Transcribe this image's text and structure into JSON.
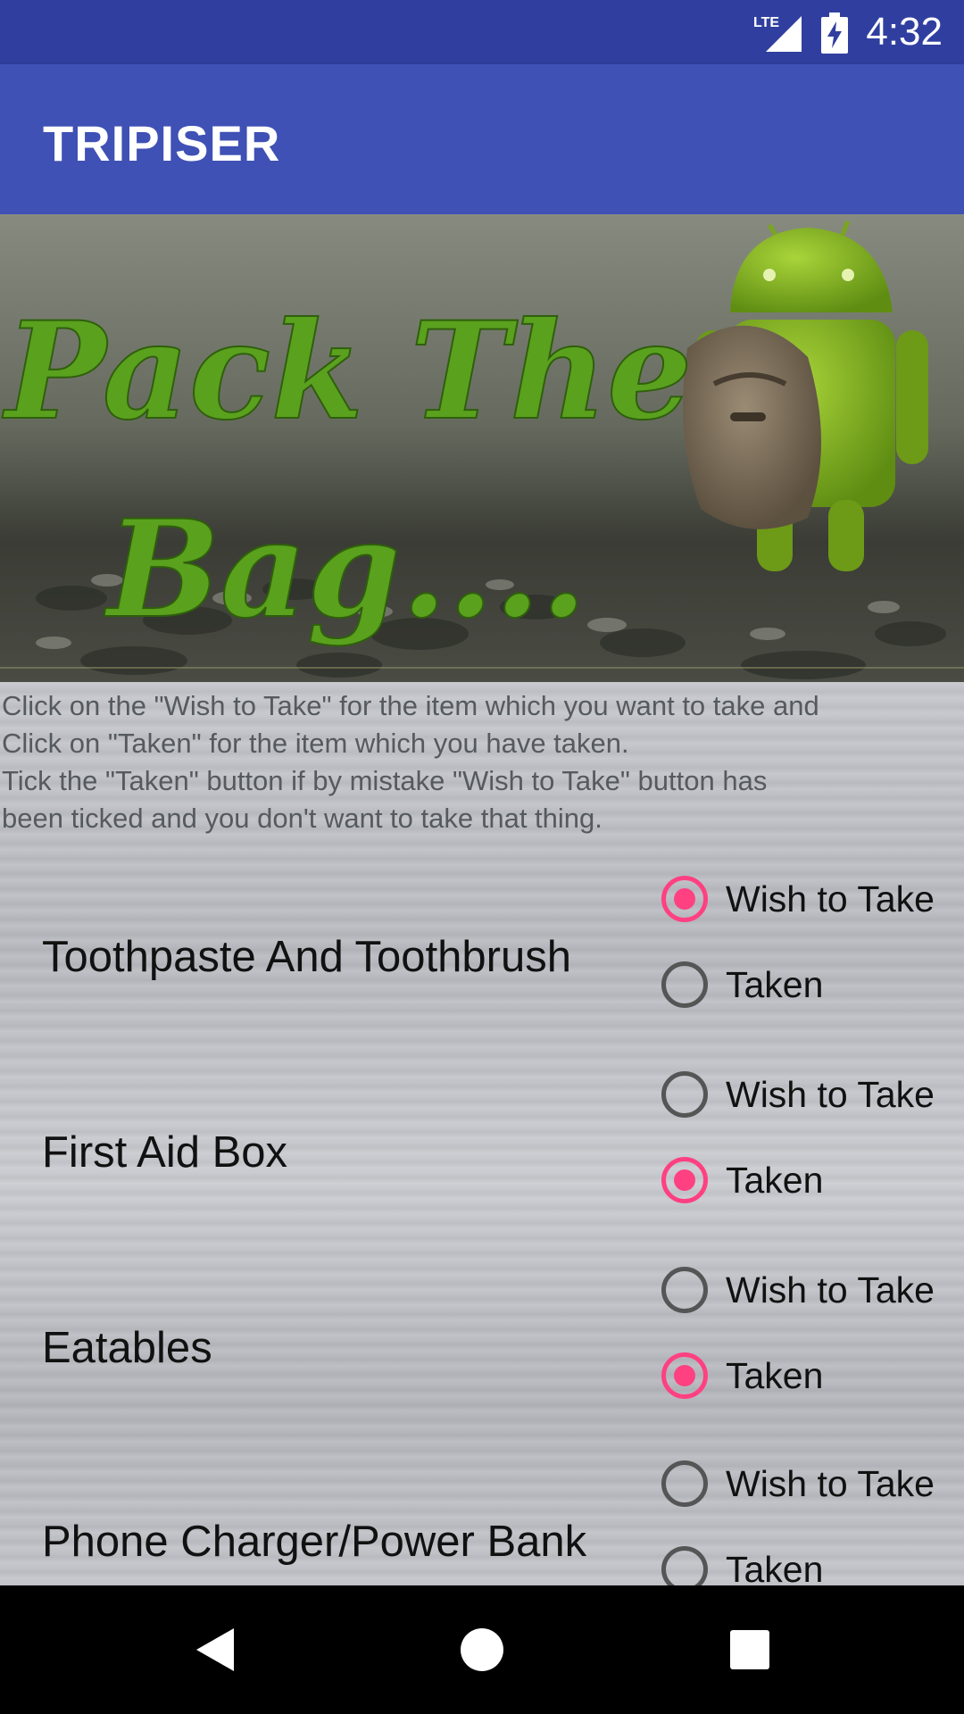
{
  "status": {
    "time": "4:32",
    "network": "LTE"
  },
  "app": {
    "title": "TRIPISER"
  },
  "banner": {
    "line1": "Pack The",
    "line2": "Bag...."
  },
  "instructions": "Click on the \"Wish to Take\" for the item which you want to take  and\nClick on \"Taken\" for the item which you have taken.\n Tick the \"Taken\" button if by mistake \"Wish to Take\" button has\nbeen ticked and you don't want to take that thing.",
  "items": [
    {
      "name": "Toothpaste And Toothbrush",
      "wish_label": "Wish to Take",
      "taken_label": "Taken",
      "selected": "wish"
    },
    {
      "name": "First Aid Box",
      "wish_label": "Wish to Take",
      "taken_label": "Taken",
      "selected": "taken"
    },
    {
      "name": "Eatables",
      "wish_label": "Wish to Take",
      "taken_label": "Taken",
      "selected": "taken"
    },
    {
      "name": "Phone Charger/Power Bank",
      "wish_label": "Wish to Take",
      "taken_label": "Taken",
      "selected": "none"
    }
  ],
  "colors": {
    "status_bar": "#303F9F",
    "app_bar": "#3F51B5",
    "accent": "#FF4081"
  }
}
